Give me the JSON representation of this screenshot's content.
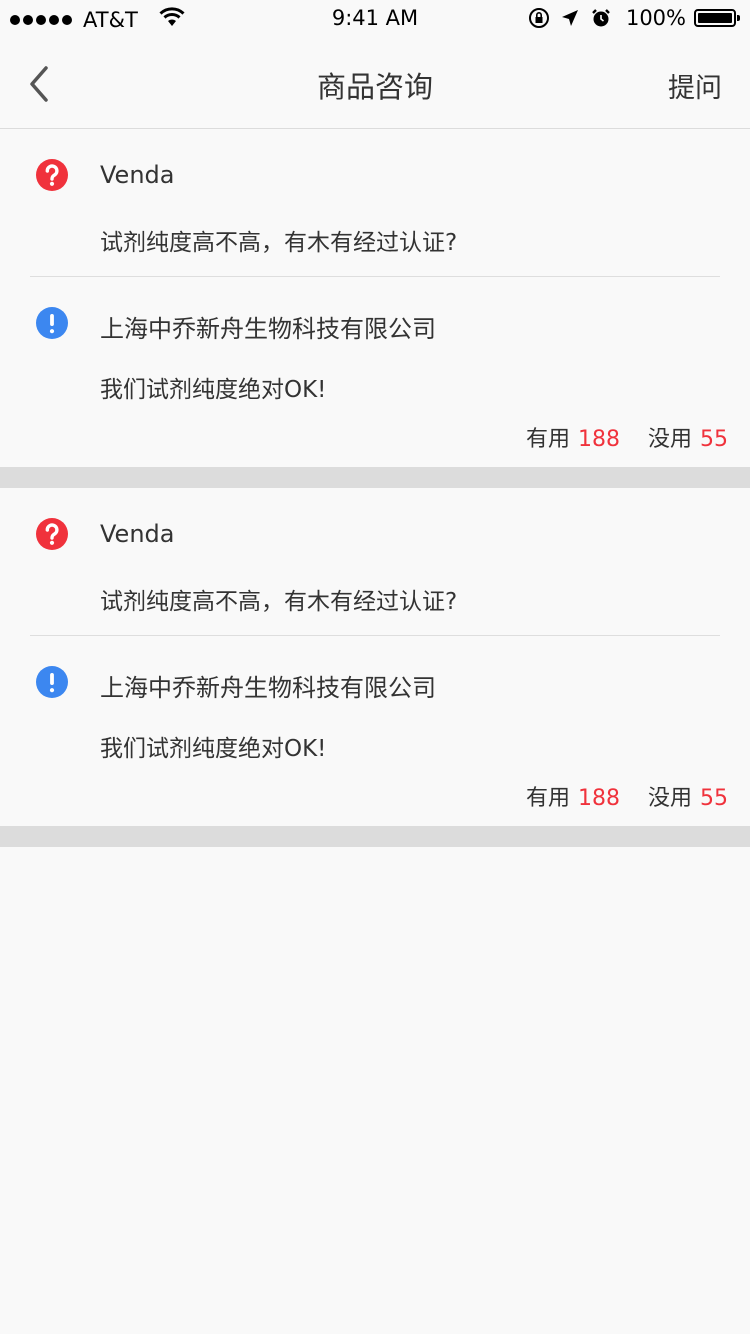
{
  "status_bar": {
    "carrier": "AT&T",
    "time": "9:41 AM",
    "battery": "100%"
  },
  "nav": {
    "title": "商品咨询",
    "ask_label": "提问"
  },
  "colors": {
    "question_icon": "#f0323c",
    "answer_icon": "#3c87f0",
    "vote_count": "#f0323c",
    "separator": "#dcdcdc"
  },
  "items": [
    {
      "question_user": "Venda",
      "question_text": "试剂纯度高不高，有木有经过认证?",
      "answer_company": "上海中乔新舟生物科技有限公司",
      "answer_text": "我们试剂纯度绝对OK!",
      "useful_label": "有用",
      "useful_count": "188",
      "useless_label": "没用",
      "useless_count": "55"
    },
    {
      "question_user": "Venda",
      "question_text": "试剂纯度高不高，有木有经过认证?",
      "answer_company": "上海中乔新舟生物科技有限公司",
      "answer_text": "我们试剂纯度绝对OK!",
      "useful_label": "有用",
      "useful_count": "188",
      "useless_label": "没用",
      "useless_count": "55"
    }
  ]
}
